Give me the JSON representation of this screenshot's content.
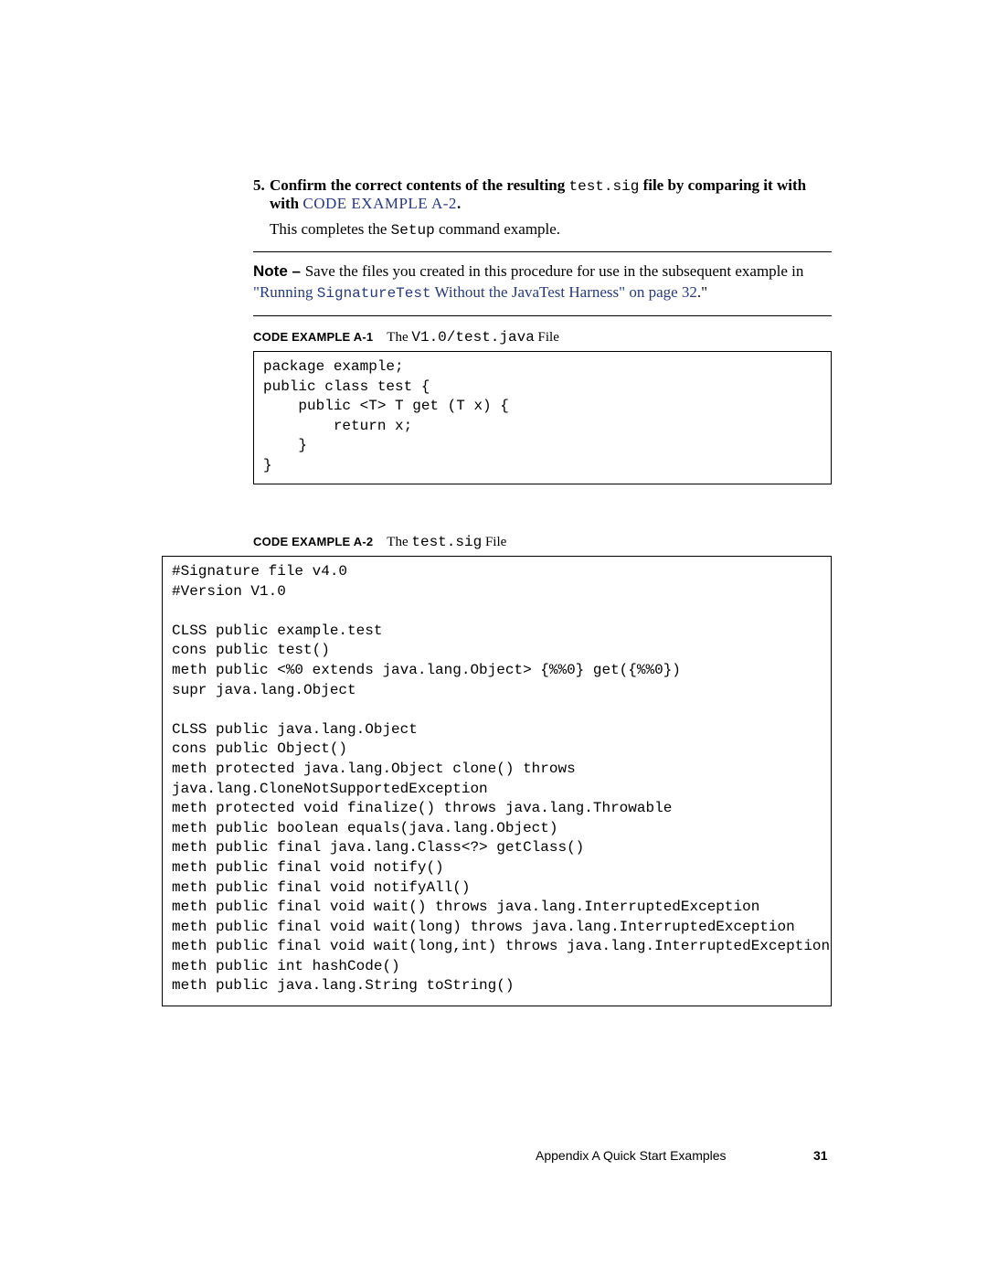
{
  "step": {
    "number": "5.",
    "lead": "Confirm the correct contents of the resulting ",
    "code_inline": "test.sig",
    "tail": " file by comparing it with ",
    "xref": "CODE EXAMPLE A-2",
    "period": ".",
    "body_pre": "This completes the ",
    "body_code": "Setup",
    "body_post": " command example."
  },
  "note": {
    "label": "Note – ",
    "text1": "Save the files you created in this procedure for use in the subsequent example in ",
    "link_open": "\"",
    "link_pre": "Running ",
    "link_code": "SignatureTest",
    "link_post": " Without the JavaTest Harness\" on page 32",
    "text2": ".\""
  },
  "ex1": {
    "label": "CODE EXAMPLE A-1",
    "caption_pre": "The ",
    "caption_code": "V1.0/test.java",
    "caption_post": " File",
    "code": "package example;\npublic class test {\n    public <T> T get (T x) {\n        return x;\n    }\n}"
  },
  "ex2": {
    "label": "CODE EXAMPLE A-2",
    "caption_pre": "The ",
    "caption_code": "test.sig",
    "caption_post": " File",
    "code": "#Signature file v4.0\n#Version V1.0\n\nCLSS public example.test\ncons public test()\nmeth public <%0 extends java.lang.Object> {%%0} get({%%0})\nsupr java.lang.Object\n\nCLSS public java.lang.Object\ncons public Object()\nmeth protected java.lang.Object clone() throws\njava.lang.CloneNotSupportedException\nmeth protected void finalize() throws java.lang.Throwable\nmeth public boolean equals(java.lang.Object)\nmeth public final java.lang.Class<?> getClass()\nmeth public final void notify()\nmeth public final void notifyAll()\nmeth public final void wait() throws java.lang.InterruptedException\nmeth public final void wait(long) throws java.lang.InterruptedException\nmeth public final void wait(long,int) throws java.lang.InterruptedException\nmeth public int hashCode()\nmeth public java.lang.String toString()"
  },
  "footer": {
    "text": "Appendix A    Quick Start Examples",
    "page": "31"
  }
}
